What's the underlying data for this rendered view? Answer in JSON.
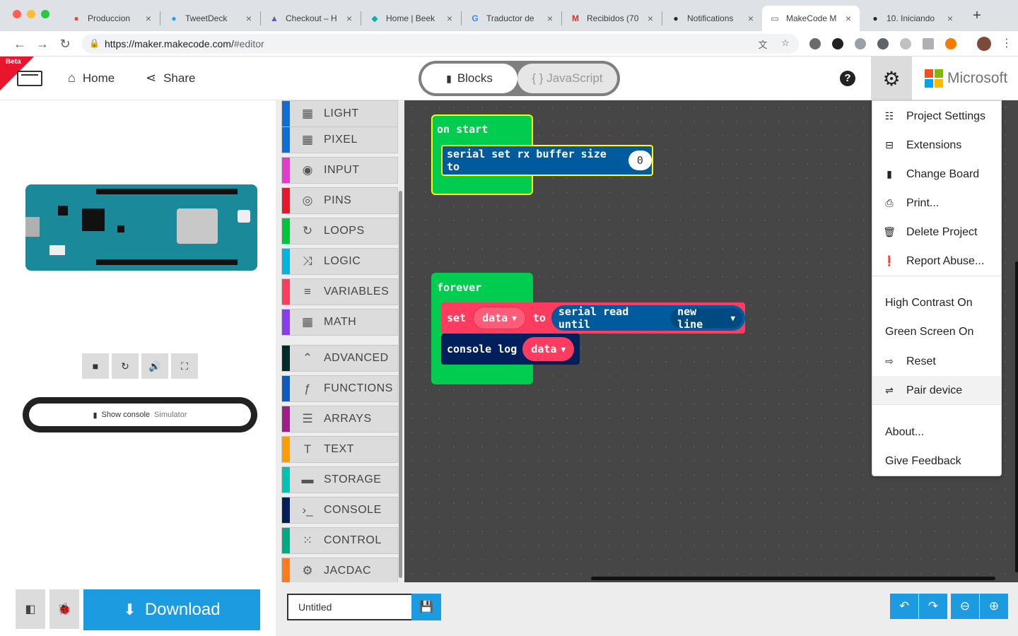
{
  "browser": {
    "tabs": [
      {
        "title": "Produccion",
        "fav": "●",
        "favColor": "#e8453c"
      },
      {
        "title": "TweetDeck",
        "fav": "●",
        "favColor": "#1da1f2"
      },
      {
        "title": "Checkout – H",
        "fav": "▲",
        "favColor": "#4a5cd1"
      },
      {
        "title": "Home | Beek",
        "fav": "◆",
        "favColor": "#00b2a9"
      },
      {
        "title": "Traductor de",
        "fav": "G",
        "favColor": "#4285f4"
      },
      {
        "title": "Recibidos (70",
        "fav": "M",
        "favColor": "#d93025"
      },
      {
        "title": "Notifications",
        "fav": "●",
        "favColor": "#24292e"
      },
      {
        "title": "MakeCode M",
        "fav": "▭",
        "favColor": "#5f6368"
      },
      {
        "title": "10. Iniciando",
        "fav": "●",
        "favColor": "#24292e"
      }
    ],
    "url_host": "https://maker.makecode.com/",
    "url_path": "#editor"
  },
  "menubar": {
    "beta": "Beta",
    "home": "Home",
    "share": "Share",
    "blocks": "Blocks",
    "javascript": "{ } JavaScript",
    "brand": "Microsoft"
  },
  "simulator": {
    "console_label": "Show console",
    "console_sub": "Simulator",
    "download": "Download"
  },
  "toolbox": [
    {
      "label": "LIGHT",
      "color": "#0f6ed6",
      "icon": "▦"
    },
    {
      "label": "PIXEL",
      "color": "#0f6ed6",
      "icon": "▦"
    },
    {
      "label": "INPUT",
      "color": "#e63acb",
      "icon": "◉"
    },
    {
      "label": "PINS",
      "color": "#e8152c",
      "icon": "◎"
    },
    {
      "label": "LOOPS",
      "color": "#00c53b",
      "icon": "↻"
    },
    {
      "label": "LOGIC",
      "color": "#00b3e0",
      "icon": "⤨"
    },
    {
      "label": "VARIABLES",
      "color": "#ff3c5f",
      "icon": "≡"
    },
    {
      "label": "MATH",
      "color": "#8c3cf0",
      "icon": "▦"
    },
    {
      "label": "ADVANCED",
      "color": "#002b2b",
      "icon": "⌃"
    },
    {
      "label": "FUNCTIONS",
      "color": "#0c5bc0",
      "icon": "ƒ"
    },
    {
      "label": "ARRAYS",
      "color": "#a21b8b",
      "icon": "☰"
    },
    {
      "label": "TEXT",
      "color": "#ff9d00",
      "icon": "T"
    },
    {
      "label": "STORAGE",
      "color": "#00c2b3",
      "icon": "▬"
    },
    {
      "label": "CONSOLE",
      "color": "#001f5b",
      "icon": "›_"
    },
    {
      "label": "CONTROL",
      "color": "#00a884",
      "icon": "⁙"
    },
    {
      "label": "JACDAC",
      "color": "#ff7a1a",
      "icon": "⚙"
    }
  ],
  "blocks": {
    "on_start": "on start",
    "serial_set": "serial set rx buffer size to",
    "serial_val": "0",
    "forever": "forever",
    "set": "set",
    "data": "data",
    "to": "to",
    "serial_read": "serial read until",
    "new_line": "new line",
    "console_log": "console log",
    "data2": "data"
  },
  "bottombar": {
    "project_name": "Untitled"
  },
  "settings_menu": [
    {
      "label": "Project Settings",
      "icon": "☷"
    },
    {
      "label": "Extensions",
      "icon": "⊟"
    },
    {
      "label": "Change Board",
      "icon": "▮"
    },
    {
      "label": "Print...",
      "icon": "⎙"
    },
    {
      "label": "Delete Project",
      "icon": "🗑"
    },
    {
      "label": "Report Abuse...",
      "icon": "❗"
    },
    {
      "label": "High Contrast On",
      "icon": ""
    },
    {
      "label": "Green Screen On",
      "icon": ""
    },
    {
      "label": "Reset",
      "icon": "⇨"
    },
    {
      "label": "Pair device",
      "icon": "⇌"
    },
    {
      "label": "About...",
      "icon": ""
    },
    {
      "label": "Give Feedback",
      "icon": ""
    }
  ]
}
